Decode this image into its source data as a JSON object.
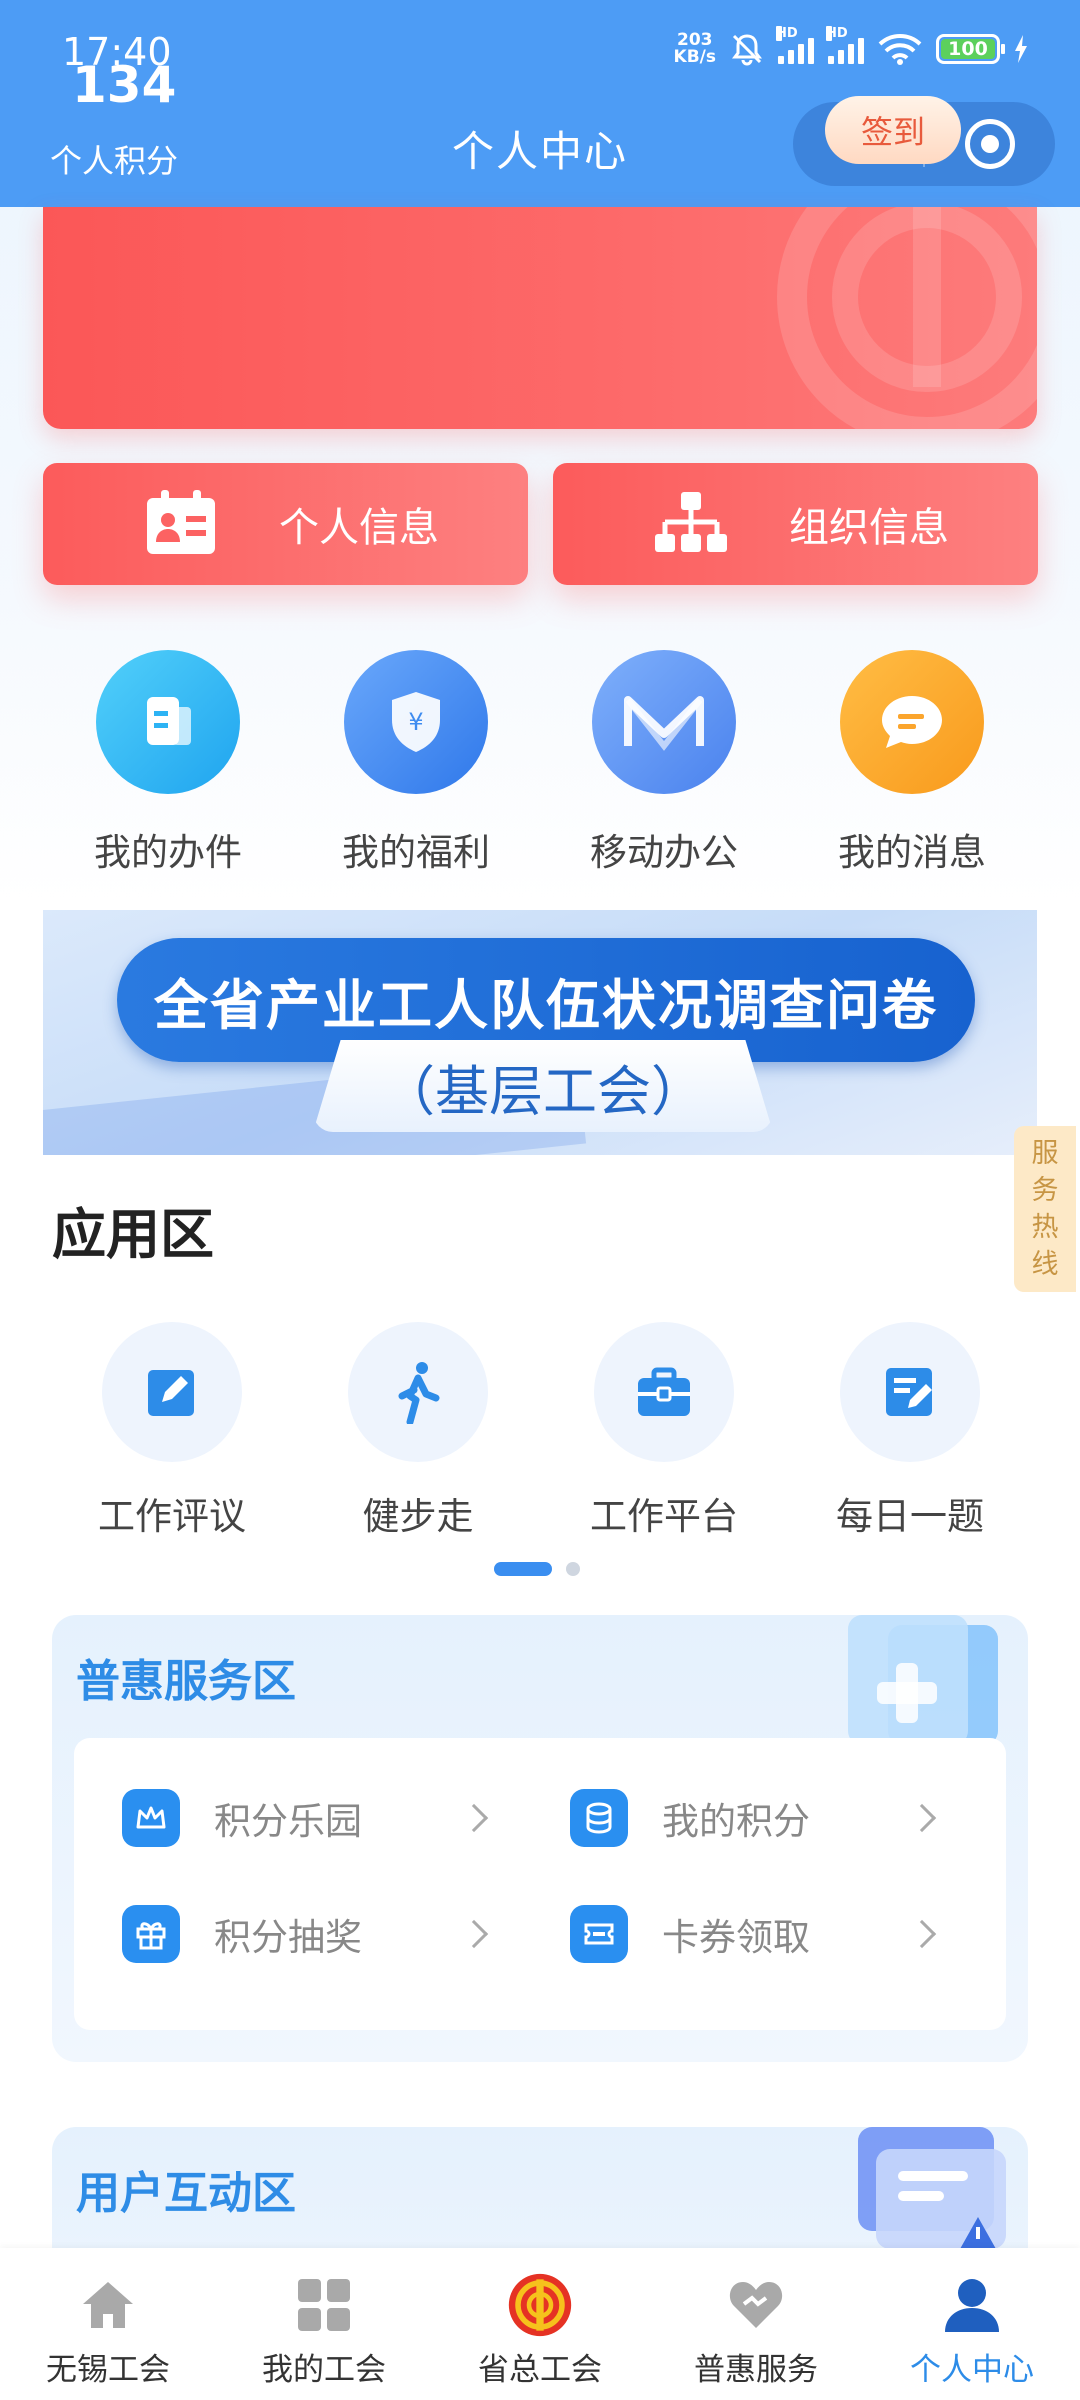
{
  "status_bar": {
    "time": "17:40",
    "speed_value": "203",
    "speed_unit": "KB/s",
    "hd_label": "HD",
    "battery": "100"
  },
  "nav_bar": {
    "title": "个人中心"
  },
  "points_card": {
    "value": "134",
    "label": "个人积分",
    "checkin_label": "签到"
  },
  "info_buttons": [
    {
      "label": "个人信息",
      "icon": "id-card-icon"
    },
    {
      "label": "组织信息",
      "icon": "org-chart-icon"
    }
  ],
  "quick_links": [
    {
      "label": "我的办件",
      "icon": "document-icon",
      "color": "#2db3f4"
    },
    {
      "label": "我的福利",
      "icon": "yuan-shield-icon",
      "color": "#3f8cf0"
    },
    {
      "label": "移动办公",
      "icon": "m-logo-icon",
      "color": "#5c93f2"
    },
    {
      "label": "我的消息",
      "icon": "message-icon",
      "color": "#fba52d"
    }
  ],
  "banner": {
    "title": "全省产业工人队伍状况调查问卷",
    "subtitle": "（基层工会）"
  },
  "hotline": {
    "label": [
      "服",
      "务",
      "热",
      "线"
    ]
  },
  "apps_section": {
    "title": "应用区",
    "items": [
      {
        "label": "工作评议",
        "icon": "edit-icon"
      },
      {
        "label": "健步走",
        "icon": "walking-icon"
      },
      {
        "label": "工作平台",
        "icon": "briefcase-icon"
      },
      {
        "label": "每日一题",
        "icon": "quiz-icon"
      }
    ],
    "page_count": 2,
    "current_page": 1
  },
  "benefit_section": {
    "title": "普惠服务区",
    "items": [
      {
        "label": "积分乐园",
        "icon": "crown-icon"
      },
      {
        "label": "我的积分",
        "icon": "coin-stack-icon"
      },
      {
        "label": "积分抽奖",
        "icon": "gift-icon"
      },
      {
        "label": "卡券领取",
        "icon": "coupon-icon"
      }
    ]
  },
  "interact_section": {
    "title": "用户互动区"
  },
  "bottom_nav": {
    "items": [
      {
        "label": "无锡工会",
        "icon": "home-icon",
        "active": false
      },
      {
        "label": "我的工会",
        "icon": "grid-icon",
        "active": false
      },
      {
        "label": "省总工会",
        "icon": "union-logo-icon",
        "active": false
      },
      {
        "label": "普惠服务",
        "icon": "heart-icon",
        "active": false
      },
      {
        "label": "个人中心",
        "icon": "user-icon",
        "active": true
      }
    ]
  },
  "colors": {
    "header_blue": "#4d9cf5",
    "card_red": "#fb5757",
    "accent_blue": "#2d8ce8",
    "hotline_bg": "#fde9c7"
  }
}
